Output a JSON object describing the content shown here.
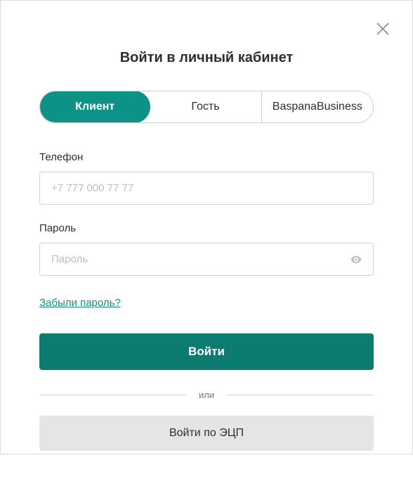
{
  "title": "Войти в личный кабинет",
  "tabs": {
    "client": "Клиент",
    "guest": "Гость",
    "business": "BaspanaBusiness"
  },
  "phone": {
    "label": "Телефон",
    "placeholder": "+7 777 000 77 77"
  },
  "password": {
    "label": "Пароль",
    "placeholder": "Пароль"
  },
  "forgot": "Забыли пароль?",
  "login_button": "Войти",
  "divider": "или",
  "ecp_button": "Войти по ЭЦП"
}
